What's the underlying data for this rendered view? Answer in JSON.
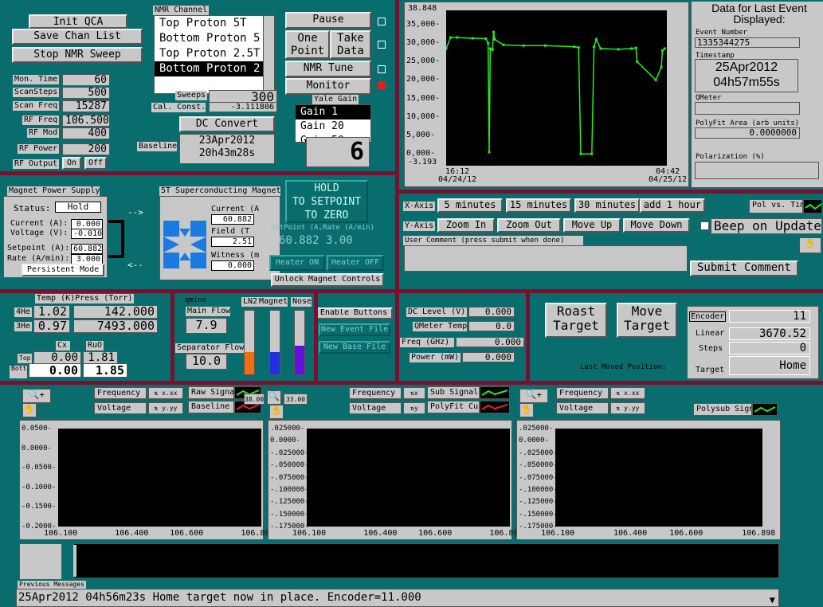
{
  "buttons": {
    "init_qca": "Init QCA",
    "save_chan_list": "Save Chan List",
    "stop_nmr_sweep": "Stop NMR Sweep",
    "pause": "Pause",
    "one_point": "One Point",
    "take_data": "Take Data",
    "nmr_tune": "NMR Tune",
    "monitor": "Monitor",
    "dc_convert": "DC Convert",
    "rf_on": "On",
    "rf_off": "Off",
    "persistent_mode": "Persistent Mode",
    "hold_to_setpoint": "HOLD",
    "to_setpoint": "TO SETPOINT",
    "to_zero": "TO ZERO",
    "heater_on": "Heater ON",
    "heater_off": "Heater OFF",
    "unlock_magnet": "Unlock Magnet Controls",
    "enable_buttons": "Enable Buttons",
    "new_event_file": "New Event File",
    "new_base_file": "New Base File",
    "roast_target": "Roast Target",
    "move_target": "Move Target",
    "submit_comment": "Submit Comment"
  },
  "nmr_channel": {
    "title": "NMR Channel",
    "items": [
      "Top Proton 5T",
      "Bottom Proton 5",
      "Top Proton 2.5T",
      "Bottom Proton 2"
    ],
    "selected_index": 3
  },
  "params": {
    "mon_time": {
      "label": "Mon. Time",
      "value": "60"
    },
    "scan_steps": {
      "label": "ScanSteps",
      "value": "500"
    },
    "scan_freq": {
      "label": "Scan Freq",
      "value": "15287"
    },
    "rf_freq": {
      "label": "RF Freq",
      "value": "106.500"
    },
    "rf_mod": {
      "label": "RF Mod",
      "value": "400"
    },
    "rf_power": {
      "label": "RF Power",
      "value": "200"
    },
    "rf_output": {
      "label": "RF Output"
    },
    "sweeps": {
      "label": "Sweeps",
      "value": "300"
    },
    "cal_const": {
      "label": "Cal. Const.",
      "value": "-3.111806"
    },
    "baseline": {
      "label": "Baseline",
      "value": "23Apr2012\n20h43m28s"
    }
  },
  "yale_gain": {
    "title": "Yale Gain",
    "items": [
      "Gain 1",
      "Gain 20",
      "Gain 50"
    ],
    "selected_index": 0,
    "digit": "6"
  },
  "main_chart": {
    "ymax_label": "38.848",
    "ymin_label": "-3.193",
    "yticks": [
      "35,000-",
      "30,000-",
      "25,000-",
      "20,000-",
      "15,000-",
      "10,000-",
      "5,000-",
      "0,000-"
    ],
    "x_start": "16:12\n04/24/12",
    "x_end": "04:42\n04/25/12",
    "x_axis_label": "X-Axis",
    "y_axis_label": "Y-Axis",
    "x_buttons": [
      "5 minutes",
      "15 minutes",
      "30 minutes",
      "add 1 hour"
    ],
    "y_buttons": [
      "Zoom In",
      "Zoom Out",
      "Move Up",
      "Move Down"
    ],
    "pol_vs_time": "Pol vs. Time",
    "beep_on_update": "Beep on Update",
    "user_comment_label": "User Comment (press submit when done)",
    "color": "#22ee22"
  },
  "chart_data": {
    "type": "line",
    "ylim": [
      -3.193,
      38.848
    ],
    "x_range": [
      "04/24/12 16:12",
      "04/25/12 04:42"
    ],
    "series": [
      {
        "values_desc": "",
        "points": [
          [
            0.0,
            28.5
          ],
          [
            0.02,
            31.5
          ],
          [
            0.05,
            31.5
          ],
          [
            0.12,
            31.3
          ],
          [
            0.18,
            31.2
          ],
          [
            0.19,
            30
          ],
          [
            0.195,
            0.5
          ],
          [
            0.2,
            28.5
          ],
          [
            0.21,
            28.2
          ],
          [
            0.215,
            33.0
          ],
          [
            0.22,
            31.0
          ],
          [
            0.26,
            29.5
          ],
          [
            0.35,
            29.3
          ],
          [
            0.45,
            29.3
          ],
          [
            0.58,
            29.0
          ],
          [
            0.6,
            28.8
          ],
          [
            0.61,
            0.0
          ],
          [
            0.66,
            0.0
          ],
          [
            0.67,
            29.0
          ],
          [
            0.68,
            31.0
          ],
          [
            0.7,
            28.5
          ],
          [
            0.78,
            28.3
          ],
          [
            0.84,
            28.5
          ],
          [
            0.86,
            28.7
          ],
          [
            0.865,
            25.0
          ],
          [
            0.95,
            20.0
          ],
          [
            0.975,
            23.5
          ],
          [
            0.98,
            28.0
          ],
          [
            0.99,
            28.5
          ]
        ]
      }
    ]
  },
  "event_data": {
    "title": "Data for Last Event Displayed:",
    "event_number_label": "Event Number",
    "event_number": "1335344275",
    "timestamp_label": "Timestamp",
    "timestamp": "25Apr2012\n04h57m55s",
    "qmeter_label": "QMeter",
    "qmeter": "",
    "polyfit_label": "PolyFit Area (arb units)",
    "polyfit": "0.0000000",
    "polarization_label": "Polarization (%)",
    "polarization": ""
  },
  "magnet_ps": {
    "title": "Magnet Power Supply",
    "status_label": "Status:",
    "status": "Hold",
    "current_label": "Current (A):",
    "current": "0.000",
    "voltage_label": "Voltage (V):",
    "voltage": "-0.010",
    "setpoint_label": "Setpoint (A):",
    "setpoint": "60.882",
    "rate_label": "Rate (A/min):",
    "rate": "3.000",
    "arrow_right": "-->",
    "arrow_left": "<--"
  },
  "sc_magnet": {
    "title": "5T Superconducting Magnet",
    "current_label": "Current (A",
    "current": "60.882",
    "field_label": "Field (T",
    "field": "2.51",
    "witness_label": "Witness (m",
    "witness": "0.000",
    "setpoint_rate_label": "SetPoint (A,Rate (A/min)",
    "setpoint_rate": "60.882  3.00"
  },
  "temps": {
    "title": "Temp (K)Press (Torr)",
    "he4_label": "4He",
    "he4_temp": "1.02",
    "he4_press": "142.000",
    "he3_label": "3He",
    "he3_temp": "0.97",
    "he3_press": "7493.000",
    "cx_label": "Cx",
    "ruo_label": "RuO",
    "top_label": "Top",
    "top_cx": "0.00",
    "top_ruo": "1.81",
    "bottom_label": "Bottom",
    "bottom_cx": "0.00",
    "bottom_ruo": "1.85"
  },
  "flows": {
    "units_label": "qmins",
    "main_flow_label": "Main Flow",
    "main_flow": "7.9",
    "sep_flow_label": "Separator Flow",
    "sep_flow": "10.0",
    "ln2_label": "LN2",
    "magnet_label": "Magnet",
    "nose_label": "Nose",
    "ln2_level": 0.35,
    "magnet_level": 0.35,
    "nose_level": 0.45,
    "ln2_color": "#f07010",
    "magnet_color": "#2030e0",
    "nose_color": "#6010e0"
  },
  "dc_levels": {
    "dc_level_label": "DC Level (V)",
    "dc_level": "0.000",
    "qmeter_temp_label": "QMeter Temp",
    "qmeter_temp": "0.0",
    "freq_label": "Freq (GHz)",
    "freq": "0.000",
    "power_label": "Power (mW)",
    "power": "0.000"
  },
  "target": {
    "encoder_label": "Encoder",
    "encoder": "11",
    "linear_label": "Linear",
    "linear": "3670.52",
    "steps_label": "Steps",
    "steps": "0",
    "target_label": "Target",
    "target": "Home",
    "last_moved_label": "Last Moved Position:"
  },
  "plots": {
    "frequency_label": "Frequency",
    "voltage_label": "Voltage",
    "raw_signal": "Raw Signal",
    "baseline": "Baseline",
    "sub_signal": "Sub Signal",
    "polyfit_curve": "PolyFit Curve",
    "polysub_signal": "Polysub Signal",
    "plot1_yticks": [
      "0.0500-",
      "0.0000-",
      "-0.0500-",
      "-0.1000-",
      "-0.1500-",
      "-0.2000-"
    ],
    "plot2_yticks": [
      ".025000-",
      "0.0000-",
      "-.025000-",
      "-.050000-",
      "-.075000-",
      "-.100000-",
      "-.125000-",
      "-.150000-",
      "-.175000-"
    ],
    "plot3_yticks": [
      ".025000-",
      "0.0000-",
      "-.025000-",
      "-.050000-",
      "-.075000-",
      "-.100000-",
      "-.125000-",
      "-.150000-",
      "-.175000-"
    ],
    "xticks1": [
      "106.100",
      "106.400",
      "106.600",
      "106.89"
    ],
    "xticks2": [
      "106.100",
      "106.400",
      "106.600",
      "106.898"
    ],
    "xticks3": [
      "106.100",
      "106.400",
      "106.600",
      "106.898"
    ],
    "partial_label": "38.00",
    "partial_label2": "33.00"
  },
  "messages": {
    "prev_label": "Previous Messages",
    "current": "25Apr2012 04h56m23s Home target now in place.  Encoder=11.000"
  }
}
